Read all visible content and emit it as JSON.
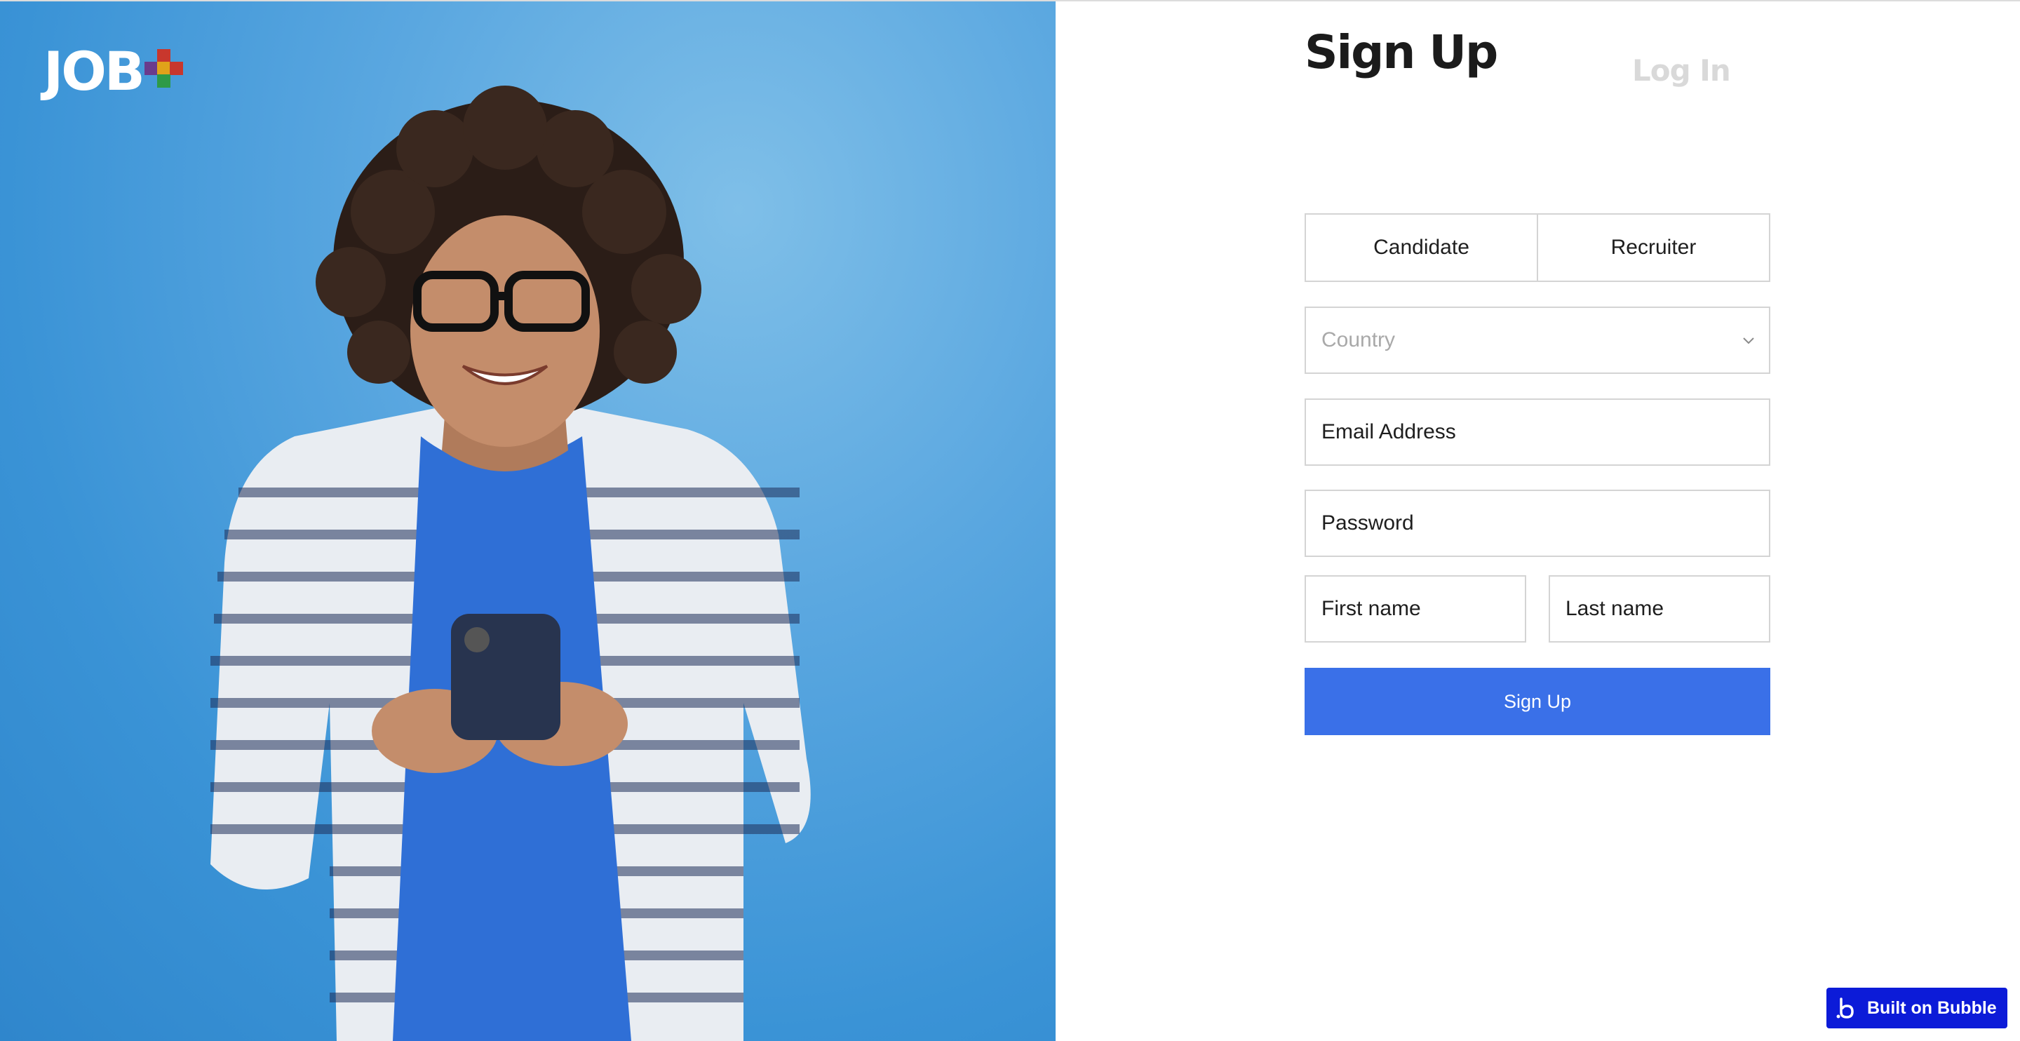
{
  "brand": {
    "logo_text": "JOB",
    "logo_colors": [
      "#c8372d",
      "#6a3b8c",
      "#2e9a47",
      "#e0a21a"
    ]
  },
  "auth_tabs": {
    "signup_label": "Sign Up",
    "login_label": "Log In"
  },
  "role_toggle": {
    "candidate_label": "Candidate",
    "recruiter_label": "Recruiter"
  },
  "form": {
    "country_placeholder": "Country",
    "email_placeholder": "Email Address",
    "password_placeholder": "Password",
    "first_name_placeholder": "First name",
    "last_name_placeholder": "Last name",
    "submit_label": "Sign Up"
  },
  "badge": {
    "label": "Built on Bubble"
  },
  "colors": {
    "primary_button": "#3a70e8",
    "hero_background": "#3a93d6",
    "badge_background": "#0c1bd8"
  }
}
